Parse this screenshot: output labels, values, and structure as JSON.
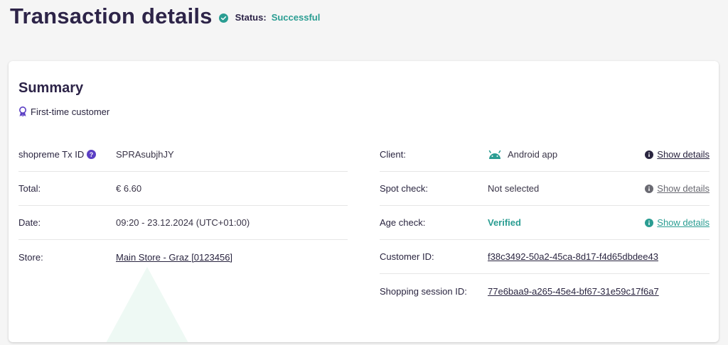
{
  "header": {
    "title": "Transaction details",
    "status_label": "Status:",
    "status_value": "Successful"
  },
  "summary": {
    "title": "Summary",
    "badge": "First-time customer"
  },
  "left": [
    {
      "label": "shopreme Tx ID",
      "value": "SPRAsubjhJY"
    },
    {
      "label": "Total:",
      "value": "€ 6.60"
    },
    {
      "label": "Date:",
      "value": "09:20 - 23.12.2024 (UTC+01:00)"
    },
    {
      "label": "Store:",
      "value": "Main Store - Graz [0123456]"
    }
  ],
  "right": [
    {
      "label": "Client:",
      "value": "Android app",
      "detail": "Show details"
    },
    {
      "label": "Spot check:",
      "value": "Not selected",
      "detail": "Show details"
    },
    {
      "label": "Age check:",
      "value": "Verified",
      "detail": "Show details"
    },
    {
      "label": "Customer ID:",
      "value": "f38c3492-50a2-45ca-8d17-f4d65dbdee43"
    },
    {
      "label": "Shopping session ID:",
      "value": "77e6baa9-a265-45e4-bf67-31e59c17f6a7"
    }
  ],
  "colors": {
    "accent_teal": "#2a9d92",
    "title_navy": "#2d2448",
    "help_purple": "#5b3fc4"
  },
  "icons": {
    "status": "check-circle-icon",
    "badge": "award-ribbon-icon",
    "help": "question-circle-icon",
    "client": "android-icon",
    "info": "info-circle-icon"
  }
}
